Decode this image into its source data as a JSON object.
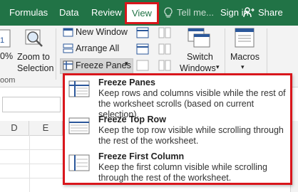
{
  "tabs": {
    "formulas": "Formulas",
    "data": "Data",
    "review": "Review",
    "view": "View",
    "tell_me": "Tell me...",
    "sign_in": "Sign in",
    "share": "Share"
  },
  "ribbon": {
    "zoom_pct": "0%",
    "zoom_to_selection_line1": "Zoom to",
    "zoom_to_selection_line2": "Selection",
    "zoom_group": "oom",
    "new_window": "New Window",
    "arrange_all": "Arrange All",
    "freeze_panes": "Freeze Panes",
    "switch_windows_line1": "Switch",
    "switch_windows_line2": "Windows",
    "macros": "Macros"
  },
  "sheet": {
    "col_d": "D",
    "col_e": "E"
  },
  "freeze_menu": {
    "items": [
      {
        "title": "Freeze Panes",
        "desc": "Keep rows and columns visible while the rest of the worksheet scrolls (based on current selection)."
      },
      {
        "title": "Freeze Top Row",
        "desc": "Keep the top row visible while scrolling through the rest of the worksheet."
      },
      {
        "title": "Freeze First Column",
        "desc": "Keep the first column visible while scrolling through the rest of the worksheet."
      }
    ]
  },
  "colors": {
    "excel_green": "#217346",
    "highlight_red": "#d9161c"
  }
}
